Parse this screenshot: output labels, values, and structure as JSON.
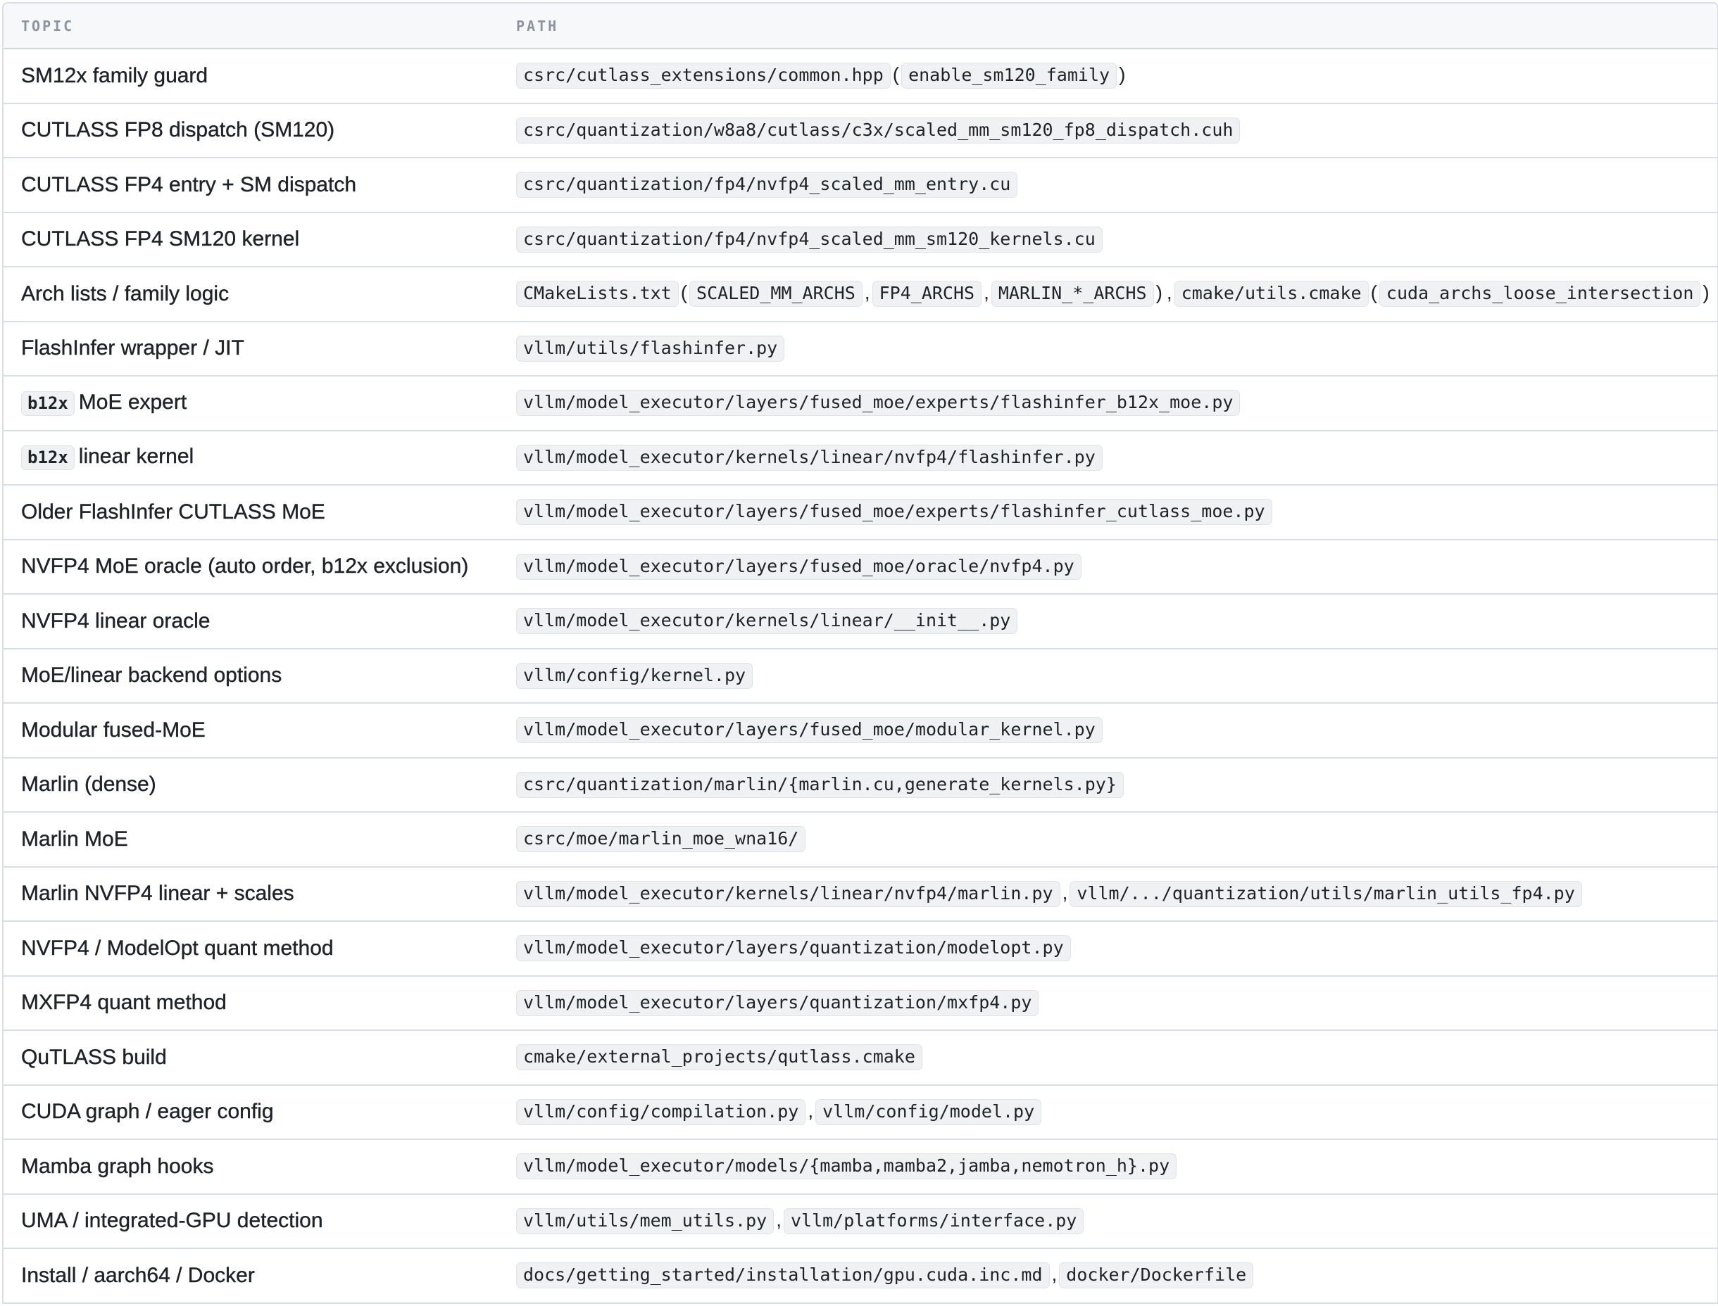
{
  "header": {
    "topic": "TOPIC",
    "path": "PATH"
  },
  "rows": [
    {
      "topic": "SM12x family guard",
      "paths": [
        "csrc/cutlass_extensions/common.hpp",
        "enable_sm120_family"
      ],
      "format": "paren"
    },
    {
      "topic": "CUTLASS FP8 dispatch (SM120)",
      "paths": [
        "csrc/quantization/w8a8/cutlass/c3x/scaled_mm_sm120_fp8_dispatch.cuh"
      ]
    },
    {
      "topic": "CUTLASS FP4 entry + SM dispatch",
      "paths": [
        "csrc/quantization/fp4/nvfp4_scaled_mm_entry.cu"
      ]
    },
    {
      "topic": "CUTLASS FP4 SM120 kernel",
      "paths": [
        "csrc/quantization/fp4/nvfp4_scaled_mm_sm120_kernels.cu"
      ]
    },
    {
      "topic": "Arch lists / family logic",
      "paths": [
        "CMakeLists.txt",
        "SCALED_MM_ARCHS",
        "FP4_ARCHS",
        "MARLIN_*_ARCHS",
        "cmake/utils.cmake",
        "cuda_archs_loose_intersection"
      ],
      "format": "arch"
    },
    {
      "topic": "FlashInfer wrapper / JIT",
      "paths": [
        "vllm/utils/flashinfer.py"
      ]
    },
    {
      "topic": "MoE expert",
      "topic_code": "b12x",
      "paths": [
        "vllm/model_executor/layers/fused_moe/experts/flashinfer_b12x_moe.py"
      ]
    },
    {
      "topic": "linear kernel",
      "topic_code": "b12x",
      "paths": [
        "vllm/model_executor/kernels/linear/nvfp4/flashinfer.py"
      ]
    },
    {
      "topic": "Older FlashInfer CUTLASS MoE",
      "paths": [
        "vllm/model_executor/layers/fused_moe/experts/flashinfer_cutlass_moe.py"
      ]
    },
    {
      "topic": "NVFP4 MoE oracle (auto order, b12x exclusion)",
      "paths": [
        "vllm/model_executor/layers/fused_moe/oracle/nvfp4.py"
      ]
    },
    {
      "topic": "NVFP4 linear oracle",
      "paths": [
        "vllm/model_executor/kernels/linear/__init__.py"
      ]
    },
    {
      "topic": "MoE/linear backend options",
      "paths": [
        "vllm/config/kernel.py"
      ]
    },
    {
      "topic": "Modular fused-MoE",
      "paths": [
        "vllm/model_executor/layers/fused_moe/modular_kernel.py"
      ]
    },
    {
      "topic": "Marlin (dense)",
      "paths": [
        "csrc/quantization/marlin/{marlin.cu,generate_kernels.py}"
      ]
    },
    {
      "topic": "Marlin MoE",
      "paths": [
        "csrc/moe/marlin_moe_wna16/"
      ]
    },
    {
      "topic": "Marlin NVFP4 linear + scales",
      "paths": [
        "vllm/model_executor/kernels/linear/nvfp4/marlin.py",
        "vllm/.../quantization/utils/marlin_utils_fp4.py"
      ]
    },
    {
      "topic": "NVFP4 / ModelOpt quant method",
      "paths": [
        "vllm/model_executor/layers/quantization/modelopt.py"
      ]
    },
    {
      "topic": "MXFP4 quant method",
      "paths": [
        "vllm/model_executor/layers/quantization/mxfp4.py"
      ]
    },
    {
      "topic": "QuTLASS build",
      "paths": [
        "cmake/external_projects/qutlass.cmake"
      ]
    },
    {
      "topic": "CUDA graph / eager config",
      "paths": [
        "vllm/config/compilation.py",
        "vllm/config/model.py"
      ]
    },
    {
      "topic": "Mamba graph hooks",
      "paths": [
        "vllm/model_executor/models/{mamba,mamba2,jamba,nemotron_h}.py"
      ]
    },
    {
      "topic": "UMA / integrated-GPU detection",
      "paths": [
        "vllm/utils/mem_utils.py",
        "vllm/platforms/interface.py"
      ]
    },
    {
      "topic": "Install / aarch64 / Docker",
      "paths": [
        "docs/getting_started/installation/gpu.cuda.inc.md",
        "docker/Dockerfile"
      ]
    }
  ],
  "separators": {
    "comma": ",",
    "open_paren": "(",
    "close_paren": ")"
  },
  "colors": {
    "header_bg": "#f6f8fa",
    "border": "#d8dee4",
    "code_bg": "#eff1f3",
    "text": "#1f2328",
    "header_text": "#8c959f"
  }
}
